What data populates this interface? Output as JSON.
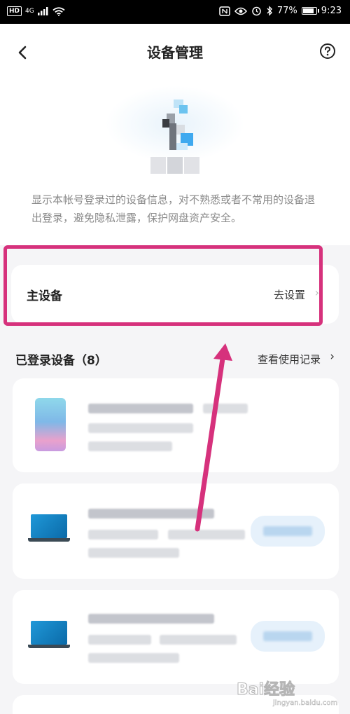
{
  "status_bar": {
    "network": "4G",
    "hd": "HD",
    "battery": "77%",
    "time": "9:23"
  },
  "header": {
    "title": "设备管理",
    "back_icon": "chevron-left-icon",
    "help_icon": "question-circle-icon"
  },
  "description": "显示本帐号登录过的设备信息，对不熟悉或者不常用的设备退出登录，避免隐私泄露，保护网盘资产安全。",
  "main_device": {
    "label": "主设备",
    "action": "去设置",
    "chevron": "›"
  },
  "logged_in": {
    "title": "已登录设备（8）",
    "link": "查看使用记录",
    "chevron": "›"
  },
  "devices": [
    {
      "type": "phone-icon"
    },
    {
      "type": "laptop-icon"
    },
    {
      "type": "laptop-icon"
    }
  ],
  "watermark": {
    "brand": "Bai经验",
    "url": "jingyan.baidu.com"
  },
  "colors": {
    "highlight": "#d6317c",
    "background": "#f5f5f7",
    "card": "#ffffff"
  }
}
